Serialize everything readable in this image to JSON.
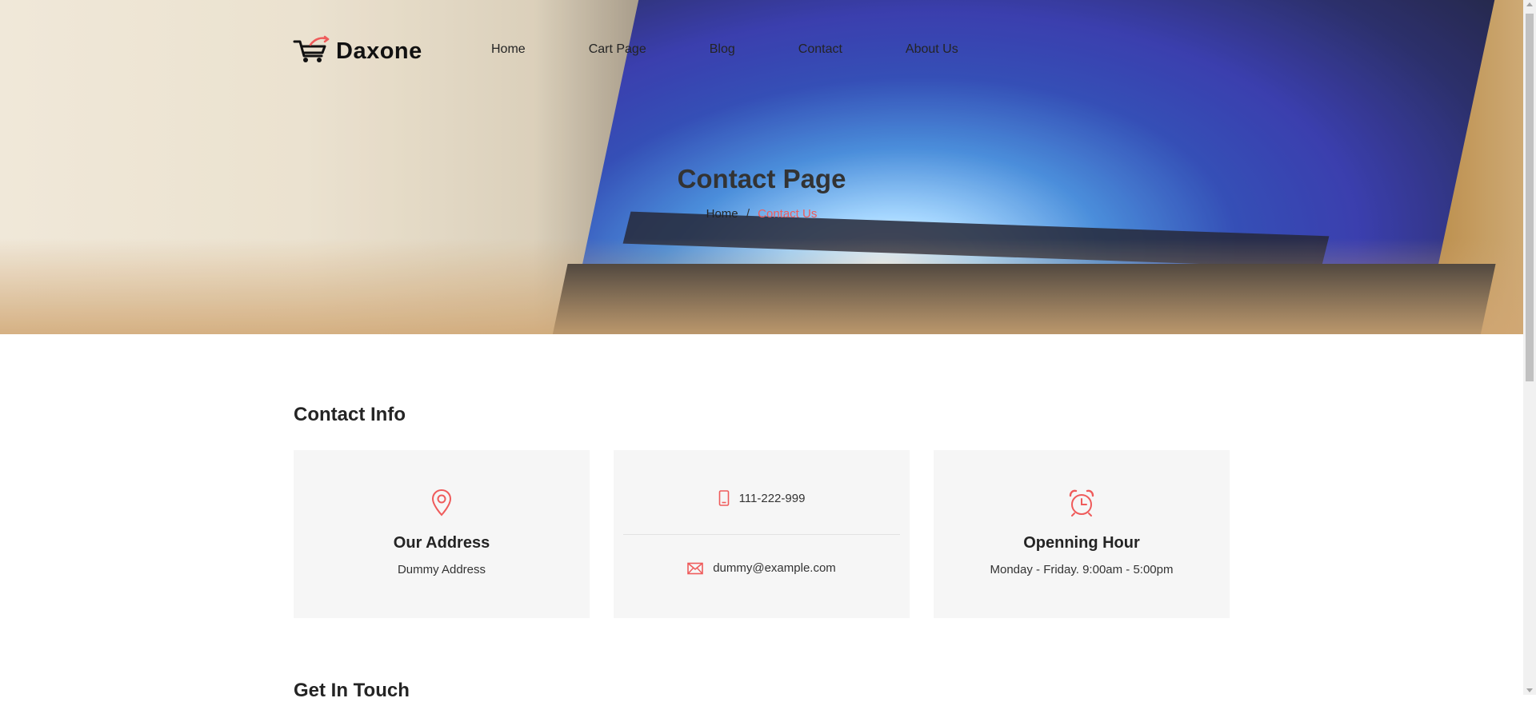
{
  "brand": {
    "name": "Daxone"
  },
  "nav": {
    "items": [
      "Home",
      "Cart Page",
      "Blog",
      "Contact",
      "About Us"
    ]
  },
  "hero": {
    "title": "Contact Page",
    "breadcrumb": {
      "home": "Home",
      "separator": "/",
      "current": "Contact Us"
    }
  },
  "contact_info": {
    "title": "Contact Info",
    "address": {
      "icon": "map-pin-icon",
      "heading": "Our Address",
      "text": "Dummy Address"
    },
    "phone": {
      "icon": "phone-icon",
      "text": "111-222-999"
    },
    "email": {
      "icon": "envelope-icon",
      "text": "dummy@example.com"
    },
    "hours": {
      "icon": "alarm-clock-icon",
      "heading": "Openning Hour",
      "text": "Monday - Friday. 9:00am - 5:00pm"
    }
  },
  "get_in_touch": {
    "title": "Get In Touch"
  },
  "colors": {
    "accent": "#ef5b5b",
    "card_bg": "#f6f6f6",
    "text": "#242424"
  }
}
